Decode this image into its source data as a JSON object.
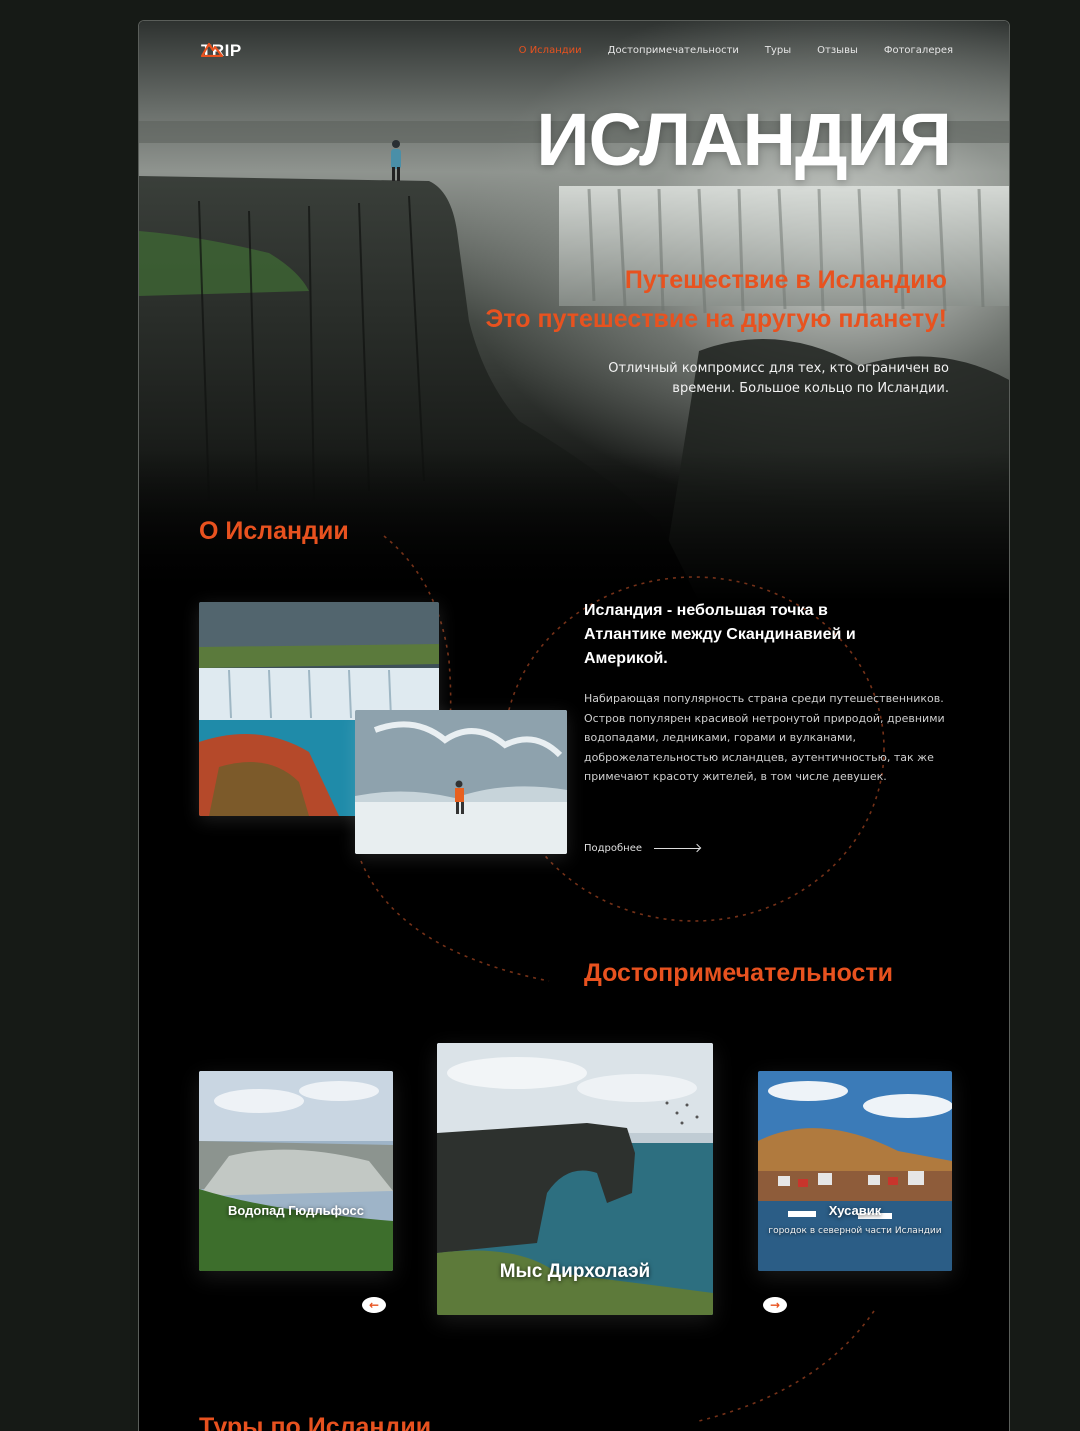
{
  "nav": {
    "logo_text": "TRIP",
    "items": [
      {
        "label": "О Исландии",
        "active": true
      },
      {
        "label": "Достопримечательности",
        "active": false
      },
      {
        "label": "Туры",
        "active": false
      },
      {
        "label": "Отзывы",
        "active": false
      },
      {
        "label": "Фотогалерея",
        "active": false
      }
    ]
  },
  "hero": {
    "title": "ИСЛАНДИЯ",
    "subtitle_line1": "Путешествие в Исландию",
    "subtitle_line2": "Это путешествие на другую планету!",
    "description": "Отличный компромисс для тех, кто ограничен во времени. Большое кольцо по Исландии."
  },
  "about": {
    "title": "О Исландии",
    "heading": "Исландия - небольшая точка в Атлантике между Скандинавией и Америкой.",
    "text": "Набирающая популярность страна среди путешественников. Остров популярен красивой нетронутой природой, древними водопадами, ледниками, горами и вулканами, доброжелательностью исландцев, аутентичностью, так же примечают красоту жителей, в том числе девушек.",
    "more_label": "Подробнее"
  },
  "sights": {
    "title": "Достопримечательности",
    "cards": [
      {
        "label": "Водопад Гюдльфосс",
        "caption": ""
      },
      {
        "label": "Мыс Дирхолаэй",
        "caption": ""
      },
      {
        "label": "Хусавик",
        "caption": "городок в северной части Исландии"
      }
    ],
    "prev_icon": "arrow-left-icon",
    "next_icon": "arrow-right-icon"
  },
  "tours": {
    "title": "Туры по Исландии"
  },
  "colors": {
    "accent": "#e8521f",
    "background": "#000000"
  }
}
